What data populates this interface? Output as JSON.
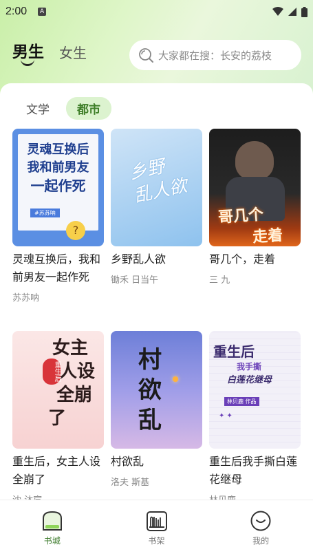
{
  "status_bar": {
    "time": "2:00",
    "notif_letter": "A"
  },
  "header": {
    "gender_tabs": [
      {
        "label": "男生",
        "active": true
      },
      {
        "label": "女生",
        "active": false
      }
    ],
    "search_placeholder": "大家都在搜：长安的荔枝"
  },
  "category_tabs": [
    {
      "label": "文学",
      "active": false
    },
    {
      "label": "都市",
      "active": true
    }
  ],
  "books": [
    {
      "title": "灵魂互换后，我和前男友一起作死",
      "author": "苏苏呐",
      "cover_text": [
        "灵魂互换后",
        "我和前男友",
        "一起作死"
      ],
      "cover_tag": "#苏苏呐"
    },
    {
      "title": "乡野乱人欲",
      "author": "锄禾 日当午",
      "cover_text": [
        "乡野",
        "乱人欲"
      ]
    },
    {
      "title": "哥几个，走着",
      "author": "三 九",
      "cover_text": [
        "哥几个",
        "走着"
      ]
    },
    {
      "title": "重生后，女主人设全崩了",
      "author": "沈 沐宸",
      "cover_text": [
        "女主",
        "人设",
        "全崩",
        "了"
      ],
      "cover_tag": "重生后"
    },
    {
      "title": "村欲乱",
      "author": "洛夫 斯基",
      "cover_text": [
        "村",
        "欲",
        "乱"
      ]
    },
    {
      "title": "重生后我手撕白莲花继母",
      "author": "林贝鹿",
      "cover_text": [
        "重生后",
        "我手撕",
        "白莲花继母"
      ],
      "cover_tag": "林贝鹿 作品"
    }
  ],
  "bottom_nav": [
    {
      "label": "书城",
      "icon": "bookstore-icon",
      "active": true
    },
    {
      "label": "书架",
      "icon": "bookshelf-icon",
      "active": false
    },
    {
      "label": "我的",
      "icon": "profile-icon",
      "active": false
    }
  ],
  "colors": {
    "accent": "#3e7e28",
    "accent_bg": "#dcf3cf",
    "header_bg": "#d6f1c4"
  }
}
